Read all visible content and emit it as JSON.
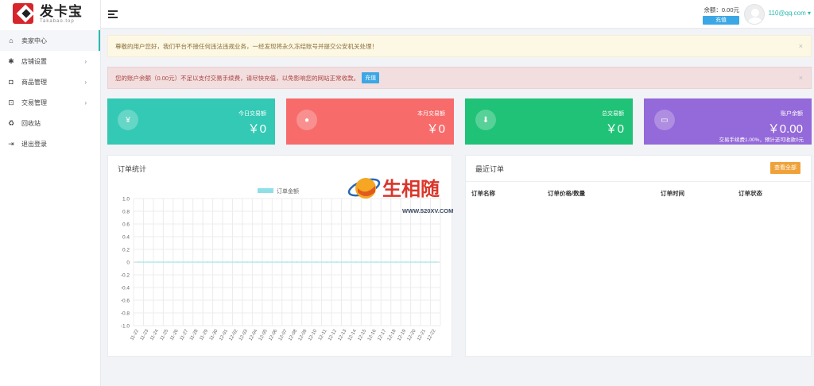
{
  "brand": {
    "title": "发卡宝",
    "subtitle": "Takabao.top"
  },
  "sidebar": {
    "items": [
      {
        "label": "卖家中心",
        "icon": "home-icon",
        "glyph": "⌂",
        "active": true,
        "has_children": false
      },
      {
        "label": "店铺设置",
        "icon": "gear-icon",
        "glyph": "✱",
        "active": false,
        "has_children": true
      },
      {
        "label": "商品管理",
        "icon": "bag-icon",
        "glyph": "◘",
        "active": false,
        "has_children": true
      },
      {
        "label": "交易管理",
        "icon": "cart-icon",
        "glyph": "⊡",
        "active": false,
        "has_children": true
      },
      {
        "label": "回收站",
        "icon": "recycle-icon",
        "glyph": "♻",
        "active": false,
        "has_children": false
      },
      {
        "label": "退出登录",
        "icon": "logout-icon",
        "glyph": "⇥",
        "active": false,
        "has_children": false
      }
    ],
    "chevron": "›"
  },
  "header": {
    "balance_text": "余额：0.00元",
    "recharge_label": "充值",
    "user_email": "110@qq.com ▾"
  },
  "alerts": {
    "warning": {
      "text": "尊敬的用户您好，我们平台不接任何违法违规业务，一经发现将永久冻结账号并提交公安机关处理！",
      "close": "×"
    },
    "danger": {
      "text": "您的账户余额（0.00元）不足以支付交易手续费，请尽快充值，以免影响您的网站正常收款。",
      "button": "充值",
      "close": "×"
    }
  },
  "cards": [
    {
      "label": "今日交易额",
      "value": "￥0",
      "icon": "yen-icon",
      "glyph": "¥",
      "color": "#33c9b4",
      "note": ""
    },
    {
      "label": "本月交易额",
      "value": "￥0",
      "icon": "user-icon",
      "glyph": "●",
      "color": "#f76b6b",
      "note": ""
    },
    {
      "label": "总交易额",
      "value": "￥0",
      "icon": "download-icon",
      "glyph": "⬇",
      "color": "#1fc276",
      "note": ""
    },
    {
      "label": "账户余额",
      "value": "￥0.00",
      "icon": "comment-icon",
      "glyph": "▭",
      "color": "#9469d9",
      "note": "交易手续费1.00%，预计还可收款0元"
    }
  ],
  "chart_panel": {
    "title": "订单统计"
  },
  "chart_data": {
    "type": "line",
    "x": [
      "11-22",
      "11-23",
      "11-24",
      "11-25",
      "11-26",
      "11-27",
      "11-28",
      "11-29",
      "11-30",
      "12-01",
      "12-02",
      "12-03",
      "12-04",
      "12-05",
      "12-06",
      "12-07",
      "12-08",
      "12-09",
      "12-10",
      "12-11",
      "12-12",
      "12-13",
      "12-14",
      "12-15",
      "12-16",
      "12-17",
      "12-18",
      "12-19",
      "12-20",
      "12-21",
      "12-22"
    ],
    "series": [
      {
        "name": "订单金额",
        "values": [
          0,
          0,
          0,
          0,
          0,
          0,
          0,
          0,
          0,
          0,
          0,
          0,
          0,
          0,
          0,
          0,
          0,
          0,
          0,
          0,
          0,
          0,
          0,
          0,
          0,
          0,
          0,
          0,
          0,
          0,
          0
        ],
        "color": "#8fe0e6"
      }
    ],
    "yticks": [
      "1.0",
      "0.8",
      "0.6",
      "0.4",
      "0.2",
      "0",
      "-0.2",
      "-0.4",
      "-0.6",
      "-0.8",
      "-1.0"
    ],
    "ylim": [
      -1.0,
      1.0
    ],
    "grid": true,
    "legend": "top-center",
    "title": "",
    "xlabel": "",
    "ylabel": ""
  },
  "orders_panel": {
    "title": "最近订单",
    "view_all": "查看全部",
    "columns": [
      "订单名称",
      "订单价格/数量",
      "订单时间",
      "订单状态"
    ]
  },
  "watermark": {
    "name": "生相随",
    "url": "WWW.520XV.COM"
  }
}
